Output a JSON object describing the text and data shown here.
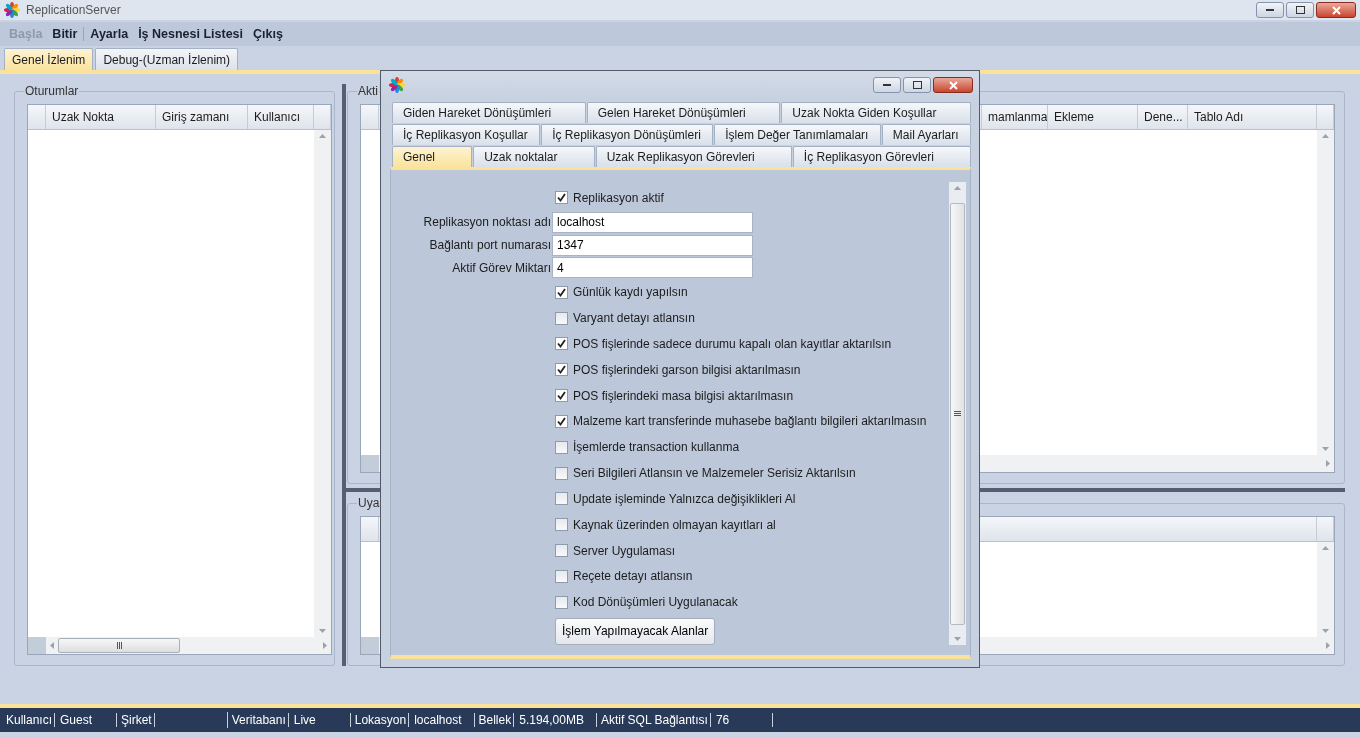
{
  "window": {
    "title": "ReplicationServer"
  },
  "menu": [
    {
      "label": "Başla",
      "disabled": true
    },
    {
      "label": "Bitir",
      "disabled": false
    },
    {
      "label": "Ayarla",
      "disabled": false
    },
    {
      "label": "İş Nesnesi Listesi",
      "disabled": false
    },
    {
      "label": "Çıkış",
      "disabled": false
    }
  ],
  "tabs": [
    {
      "label": "Genel İzlenim",
      "selected": true
    },
    {
      "label": "Debug-(Uzman İzlenim)",
      "selected": false
    }
  ],
  "sessions": {
    "title": "Oturumlar",
    "columns": [
      "Uzak Nokta",
      "Giriş zamanı",
      "Kullanıcı"
    ]
  },
  "active_panel": {
    "title": "Akti",
    "columns": [
      "mamlanma",
      "Ekleme",
      "Dene...",
      "Tablo Adı"
    ]
  },
  "warnings_panel": {
    "title": "Uya"
  },
  "dialog": {
    "tab_rows": [
      [
        {
          "label": "Giden Hareket Dönüşümleri",
          "selected": false
        },
        {
          "label": "Gelen Hareket Dönüşümleri",
          "selected": false
        },
        {
          "label": "Uzak Nokta Giden Koşullar",
          "selected": false
        }
      ],
      [
        {
          "label": "İç Replikasyon Koşullar",
          "selected": false
        },
        {
          "label": "İç Replikasyon Dönüşümleri",
          "selected": false
        },
        {
          "label": "İşlem Değer Tanımlamaları",
          "selected": false
        },
        {
          "label": "Mail Ayarları",
          "selected": false
        }
      ],
      [
        {
          "label": "Genel",
          "selected": true
        },
        {
          "label": "Uzak noktalar",
          "selected": false
        },
        {
          "label": "Uzak Replikasyon Görevleri",
          "selected": false
        },
        {
          "label": "İç Replikasyon Görevleri",
          "selected": false
        }
      ]
    ],
    "fields": [
      {
        "kind": "checkbox",
        "label": "Replikasyon aktif",
        "checked": true
      },
      {
        "kind": "text",
        "label": "Replikasyon noktası adı",
        "value": "localhost"
      },
      {
        "kind": "text",
        "label": "Bağlantı port numarası",
        "value": "1347"
      },
      {
        "kind": "text",
        "label": "Aktif Görev Miktarı",
        "value": "4"
      },
      {
        "kind": "checkbox",
        "label": "Günlük kaydı yapılsın",
        "checked": true
      },
      {
        "kind": "checkbox",
        "label": "Varyant detayı atlansın",
        "checked": false
      },
      {
        "kind": "checkbox",
        "label": "POS fişlerinde sadece durumu kapalı olan kayıtlar aktarılsın",
        "checked": true
      },
      {
        "kind": "checkbox",
        "label": "POS fişlerindeki garson bilgisi aktarılmasın",
        "checked": true
      },
      {
        "kind": "checkbox",
        "label": "POS fişlerindeki masa bilgisi aktarılmasın",
        "checked": true
      },
      {
        "kind": "checkbox",
        "label": "Malzeme kart transferinde muhasebe bağlantı bilgileri aktarılmasın",
        "checked": true
      },
      {
        "kind": "checkbox",
        "label": "İşemlerde transaction kullanma",
        "checked": false
      },
      {
        "kind": "checkbox",
        "label": "Seri Bilgileri Atlansın ve Malzemeler Serisiz Aktarılsın",
        "checked": false
      },
      {
        "kind": "checkbox",
        "label": "Update işleminde Yalnızca değişiklikleri Al",
        "checked": false
      },
      {
        "kind": "checkbox",
        "label": "Kaynak üzerinden olmayan kayıtları al",
        "checked": false
      },
      {
        "kind": "checkbox",
        "label": "Server Uygulaması",
        "checked": false
      },
      {
        "kind": "checkbox",
        "label": "Reçete detayı atlansın",
        "checked": false
      },
      {
        "kind": "checkbox",
        "label": "Kod Dönüşümleri Uygulanacak",
        "checked": false
      }
    ],
    "button": "İşlem Yapılmayacak Alanlar"
  },
  "status_bar": [
    {
      "label": "Kullanıcı",
      "value": "Guest"
    },
    {
      "label": "Şirket"
    },
    {
      "label": "Veritabanı",
      "value": "Live"
    },
    {
      "label": "Lokasyon",
      "value": "localhost"
    },
    {
      "label": "Bellek",
      "value": "5.194,00MB"
    },
    {
      "label": "Aktif SQL Bağlantısı",
      "value": "76"
    }
  ]
}
